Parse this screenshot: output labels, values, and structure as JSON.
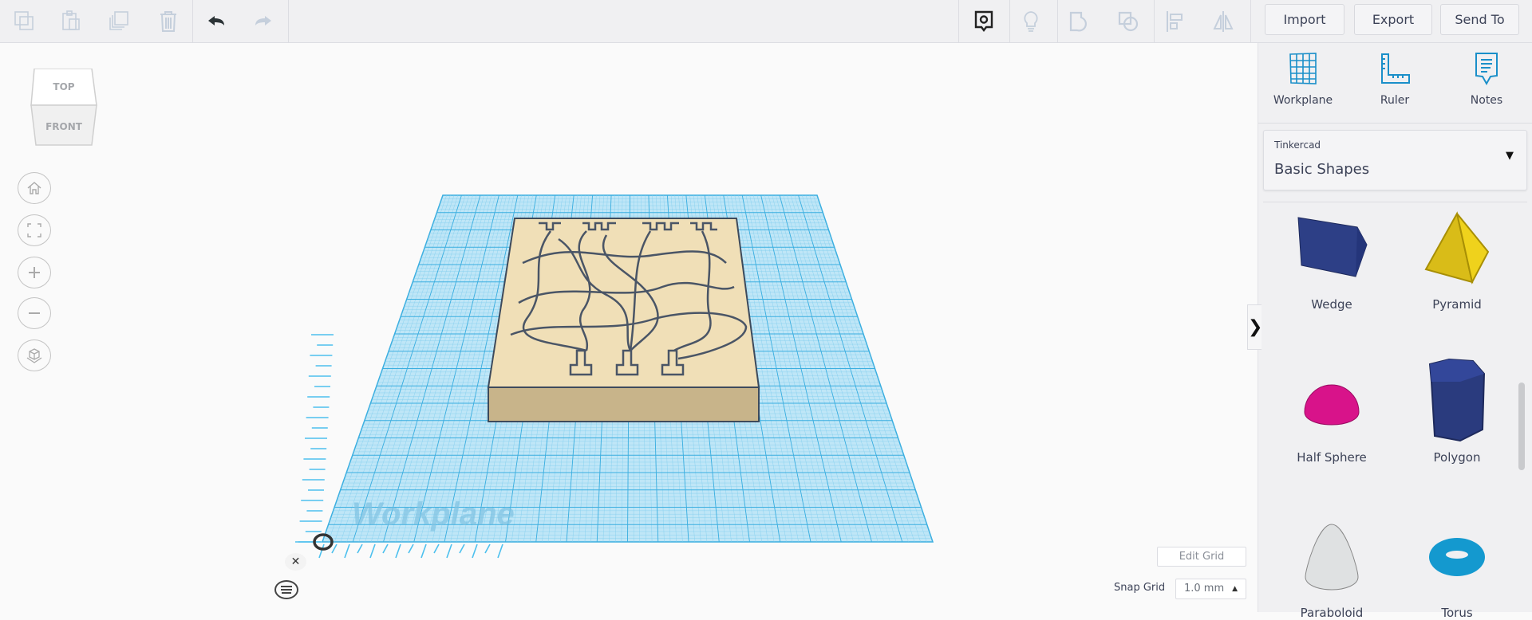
{
  "toolbar": {
    "left_icons": [
      "copy-icon",
      "paste-icon",
      "duplicate-icon",
      "delete-icon",
      "undo-icon",
      "redo-icon"
    ],
    "right_icons": [
      "show-all-icon",
      "bulb-icon",
      "group-icon",
      "ungroup-icon",
      "align-icon",
      "mirror-icon"
    ],
    "import_label": "Import",
    "export_label": "Export",
    "send_to_label": "Send To"
  },
  "viewcube": {
    "top": "TOP",
    "front": "FRONT"
  },
  "nav_buttons": [
    "home-icon",
    "fit-icon",
    "zoom-in-icon",
    "zoom-out-icon",
    "perspective-icon"
  ],
  "workplane_watermark": "Workplane",
  "panel": {
    "tools": [
      {
        "label": "Workplane"
      },
      {
        "label": "Ruler"
      },
      {
        "label": "Notes"
      }
    ],
    "library": {
      "source": "Tinkercad",
      "selected": "Basic Shapes"
    },
    "shapes": [
      {
        "label": "Wedge",
        "color": "#2d3f86"
      },
      {
        "label": "Pyramid",
        "color": "#e3c21a"
      },
      {
        "label": "Half Sphere",
        "color": "#d8138a"
      },
      {
        "label": "Polygon",
        "color": "#2d3f86"
      },
      {
        "label": "Paraboloid",
        "color": "#e0e2e3"
      },
      {
        "label": "Torus",
        "color": "#1499cf"
      }
    ]
  },
  "grid": {
    "edit_label": "Edit Grid",
    "snap_label": "Snap Grid",
    "snap_value": "1.0 mm"
  },
  "colors": {
    "workplane": "#5bc0eb",
    "model_top": "#f0dfb7",
    "model_side": "#c8b48a",
    "accent": "#1a8fc9"
  }
}
